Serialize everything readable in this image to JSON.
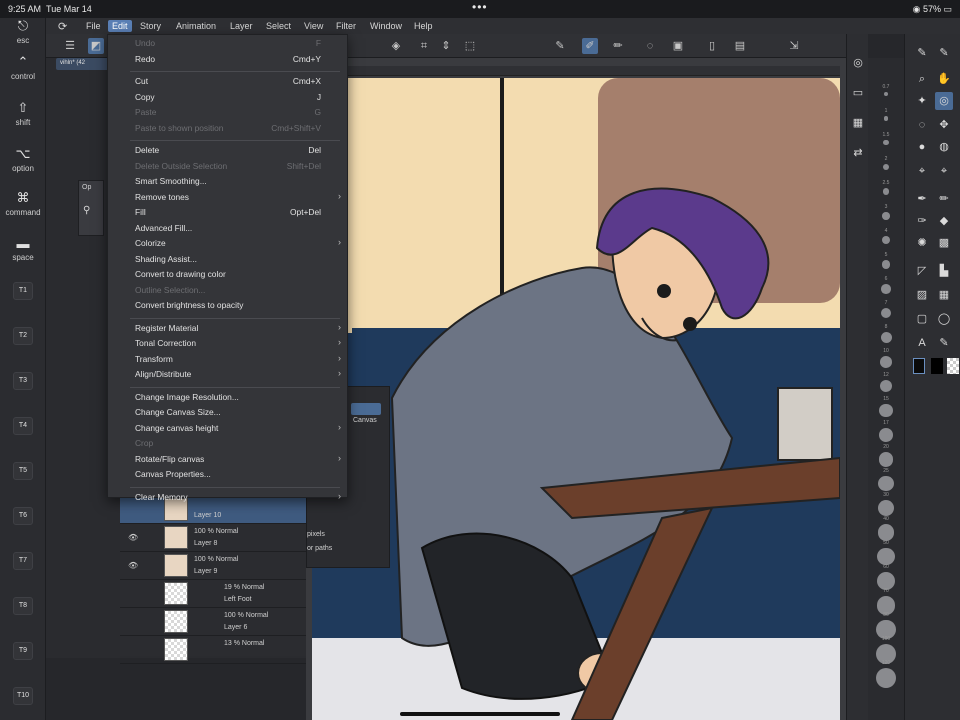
{
  "status": {
    "time": "9:25 AM",
    "date": "Tue Mar 14",
    "dots": "•••",
    "battery": "57%"
  },
  "touchbar": {
    "keys": [
      {
        "label": "esc",
        "icon": "⎋"
      },
      {
        "label": "control",
        "icon": "⌃"
      },
      {
        "label": "shift",
        "icon": "⇧"
      },
      {
        "label": "option",
        "icon": "⌥"
      },
      {
        "label": "command",
        "icon": "⌘"
      },
      {
        "label": "space",
        "icon": "▬"
      }
    ],
    "tbuttons": [
      "T1",
      "T2",
      "T3",
      "T4",
      "T5",
      "T6",
      "T7",
      "T8",
      "T9",
      "T10"
    ]
  },
  "menubar": {
    "items": [
      "File",
      "Edit",
      "Story",
      "Animation",
      "Layer",
      "Select",
      "View",
      "Filter",
      "Window",
      "Help"
    ],
    "active": "Edit"
  },
  "document_tab": "vihln* (42",
  "edit_menu": [
    {
      "label": "Undo",
      "shortcut": "F",
      "disabled": true
    },
    {
      "label": "Redo",
      "shortcut": "Cmd+Y"
    },
    {
      "sep": true
    },
    {
      "label": "Cut",
      "shortcut": "Cmd+X"
    },
    {
      "label": "Copy",
      "shortcut": "J"
    },
    {
      "label": "Paste",
      "shortcut": "G",
      "disabled": true
    },
    {
      "label": "Paste to shown position",
      "shortcut": "Cmd+Shift+V",
      "disabled": true
    },
    {
      "sep": true
    },
    {
      "label": "Delete",
      "shortcut": "Del"
    },
    {
      "label": "Delete Outside Selection",
      "shortcut": "Shift+Del",
      "disabled": true
    },
    {
      "label": "Smart Smoothing..."
    },
    {
      "label": "Remove tones",
      "submenu": true
    },
    {
      "label": "Fill",
      "shortcut": "Opt+Del"
    },
    {
      "label": "Advanced Fill..."
    },
    {
      "label": "Colorize",
      "submenu": true
    },
    {
      "label": "Shading Assist..."
    },
    {
      "label": "Convert to drawing color"
    },
    {
      "label": "Outline Selection...",
      "disabled": true
    },
    {
      "label": "Convert brightness to opacity"
    },
    {
      "sep": true
    },
    {
      "label": "Register Material",
      "submenu": true
    },
    {
      "label": "Tonal Correction",
      "submenu": true
    },
    {
      "label": "Transform",
      "submenu": true
    },
    {
      "label": "Align/Distribute",
      "submenu": true
    },
    {
      "sep": true
    },
    {
      "label": "Change Image Resolution..."
    },
    {
      "label": "Change Canvas Size..."
    },
    {
      "label": "Change canvas height",
      "submenu": true
    },
    {
      "label": "Crop",
      "disabled": true
    },
    {
      "label": "Rotate/Flip canvas",
      "submenu": true
    },
    {
      "label": "Canvas Properties..."
    },
    {
      "sep": true
    },
    {
      "label": "Clear Memory",
      "submenu": true
    }
  ],
  "layers": [
    {
      "eye": "",
      "blend": "",
      "name": "Layer 10",
      "active": true
    },
    {
      "eye": "👁",
      "blend": "100 %  Normal",
      "name": "Layer 8"
    },
    {
      "eye": "👁",
      "blend": "100 %  Normal",
      "name": "Layer 9"
    },
    {
      "eye": "",
      "blend": "19 %  Normal",
      "name": "Left Foot",
      "sub": true
    },
    {
      "eye": "",
      "blend": "100 %  Normal",
      "name": "Layer 6",
      "sub": true
    },
    {
      "eye": "",
      "blend": "13 %  Normal",
      "name": "",
      "sub": true
    }
  ],
  "property_panel": {
    "canvas_label": "Canvas",
    "pixels": "pixels",
    "paths": "or paths"
  },
  "left_panel_labels": [
    "Op",
    ""
  ],
  "right_numbers": [
    "0.7",
    "1",
    "1.5",
    "2",
    "2.5",
    "3",
    "4",
    "5",
    "6",
    "7",
    "8",
    "10",
    "12",
    "15",
    "17",
    "20",
    "25",
    "30",
    "40",
    "50",
    "60",
    "70",
    "80",
    "100",
    "120"
  ],
  "colors": {
    "accent": "#4a6b95",
    "menu_bg": "#343539",
    "bg": "#26272b",
    "canvas_wall": "#f3dcb0",
    "sofa": "#1f3a5c",
    "hair": "#5b3a8c",
    "jacket": "#6c7484",
    "table": "#6b3f2b"
  }
}
